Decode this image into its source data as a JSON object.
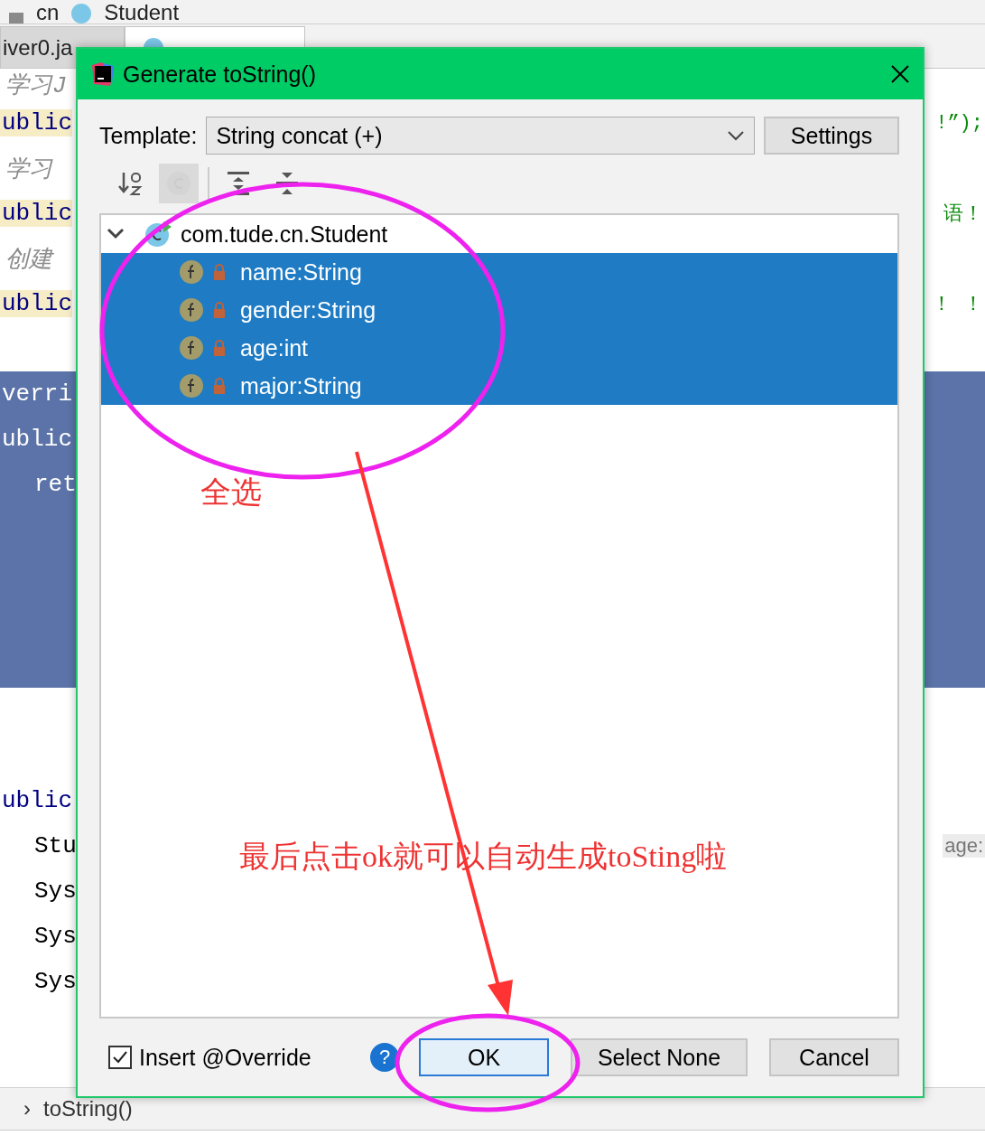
{
  "breadcrumbs": [
    "cn",
    "Student"
  ],
  "editor_tabs": [
    {
      "label": "iver0.ja",
      "selected": false
    },
    {
      "selected": true
    }
  ],
  "code_lines": [
    {
      "kind": "comment",
      "left": "学习J",
      "selected": false
    },
    {
      "kind": "marked",
      "left": "ublic",
      "right": {
        "kind": "string",
        "text": "!”);"
      },
      "selected": false
    },
    {
      "kind": "comment",
      "left": "学习",
      "selected": false
    },
    {
      "kind": "marked",
      "left": "ublic",
      "right": {
        "kind": "string",
        "text": "语！"
      },
      "selected": false
    },
    {
      "kind": "comment",
      "left": "创建",
      "selected": false
    },
    {
      "kind": "marked",
      "left": "ublic",
      "right": {
        "kind": "string",
        "text": "！ ！"
      },
      "selected": false
    },
    {
      "kind": "blank",
      "selected": false
    },
    {
      "kind": "annotation",
      "left": "verri",
      "selected": true
    },
    {
      "kind": "keyword",
      "left": "ublic",
      "selected": true
    },
    {
      "kind": "code",
      "left": "ret",
      "selected": true
    },
    {
      "kind": "blank",
      "selected": true
    },
    {
      "kind": "blank",
      "selected": true
    },
    {
      "kind": "blank",
      "selected": true
    },
    {
      "kind": "blank",
      "selected": true
    },
    {
      "kind": "blank",
      "selected": false
    },
    {
      "kind": "blank",
      "selected": false
    },
    {
      "kind": "keyword",
      "left": "ublic",
      "selected": false
    },
    {
      "kind": "code",
      "left": "Stu",
      "right": {
        "kind": "hint",
        "text": "age:"
      },
      "selected": false
    },
    {
      "kind": "code",
      "left": "Sys",
      "selected": false
    },
    {
      "kind": "code",
      "left": "Sys",
      "selected": false
    },
    {
      "kind": "code",
      "left": "Sys",
      "selected": false
    }
  ],
  "status_bar": {
    "separator": "›",
    "location": "toString()"
  },
  "dialog": {
    "title": "Generate toString()",
    "template_label": "Template:",
    "template_value": "String concat (+)",
    "settings_button": "Settings",
    "toolbar": [
      {
        "kind": "sort",
        "selected": false,
        "disabled": false
      },
      {
        "kind": "class-filter",
        "selected": true,
        "disabled": true
      },
      {
        "kind": "expand",
        "selected": false,
        "disabled": false
      },
      {
        "kind": "collapse",
        "selected": false,
        "disabled": false
      }
    ],
    "tree": {
      "label": "com.tude.cn.Student",
      "expanded": true,
      "children": [
        {
          "label": "name:String",
          "selected": true
        },
        {
          "label": "gender:String",
          "selected": true
        },
        {
          "label": "age:int",
          "selected": true
        },
        {
          "label": "major:String",
          "selected": true
        }
      ]
    },
    "insert_override": {
      "label": "Insert @Override",
      "checked": true
    },
    "help_button": "?",
    "buttons": [
      {
        "label": "OK",
        "default": true
      },
      {
        "label": "Select None",
        "default": false
      },
      {
        "label": "Cancel",
        "default": false
      }
    ]
  },
  "annotations": [
    {
      "kind": "label",
      "text": "全选"
    },
    {
      "kind": "label",
      "text": "最后点击ok就可以自动生成toSting啦"
    }
  ]
}
